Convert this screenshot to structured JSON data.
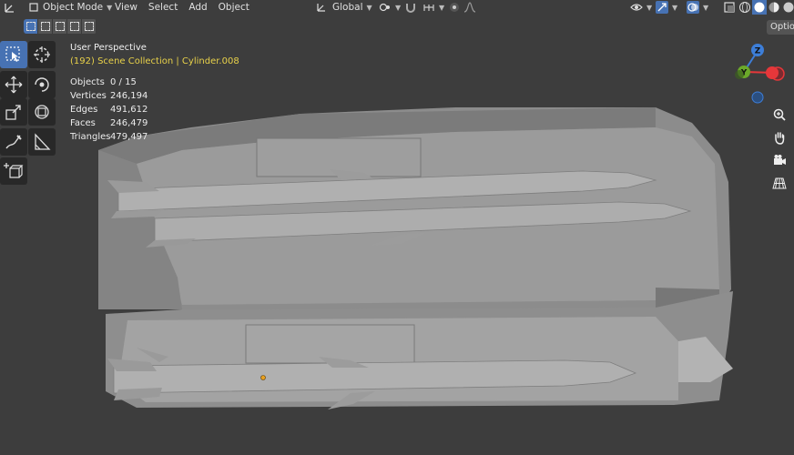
{
  "header": {
    "mode_label": "Object Mode",
    "menus": [
      "View",
      "Select",
      "Add",
      "Object"
    ],
    "transform_orientation": "Global",
    "options_label": "Options"
  },
  "overlay": {
    "view_name": "User Perspective",
    "collection": "(192) Scene Collection | Cylinder.008",
    "stats": [
      {
        "label": "Objects",
        "value": "0 / 15"
      },
      {
        "label": "Vertices",
        "value": "246,194"
      },
      {
        "label": "Edges",
        "value": "491,612"
      },
      {
        "label": "Faces",
        "value": "246,479"
      },
      {
        "label": "Triangles",
        "value": "479,497"
      }
    ]
  },
  "gizmo": {
    "z_label": "Z",
    "y_label": "Y",
    "x_color": "#e6373a",
    "y_color": "#6ba92a",
    "z_color": "#3d7ed8"
  },
  "colors": {
    "background": "#3d3d3d",
    "active_tool": "#4772b3",
    "model_light": "#a5a5a5",
    "model_dark": "#8a8a8a",
    "collection_text": "#e8d14a"
  },
  "icons": {
    "tools": [
      "select-box-icon",
      "cursor-icon",
      "move-icon",
      "rotate-icon",
      "scale-icon",
      "transform-icon",
      "annotate-icon",
      "measure-icon",
      "add-cube-icon"
    ],
    "navigation": [
      "zoom-icon",
      "hand-pan-icon",
      "camera-icon",
      "grid-perspective-icon"
    ]
  }
}
